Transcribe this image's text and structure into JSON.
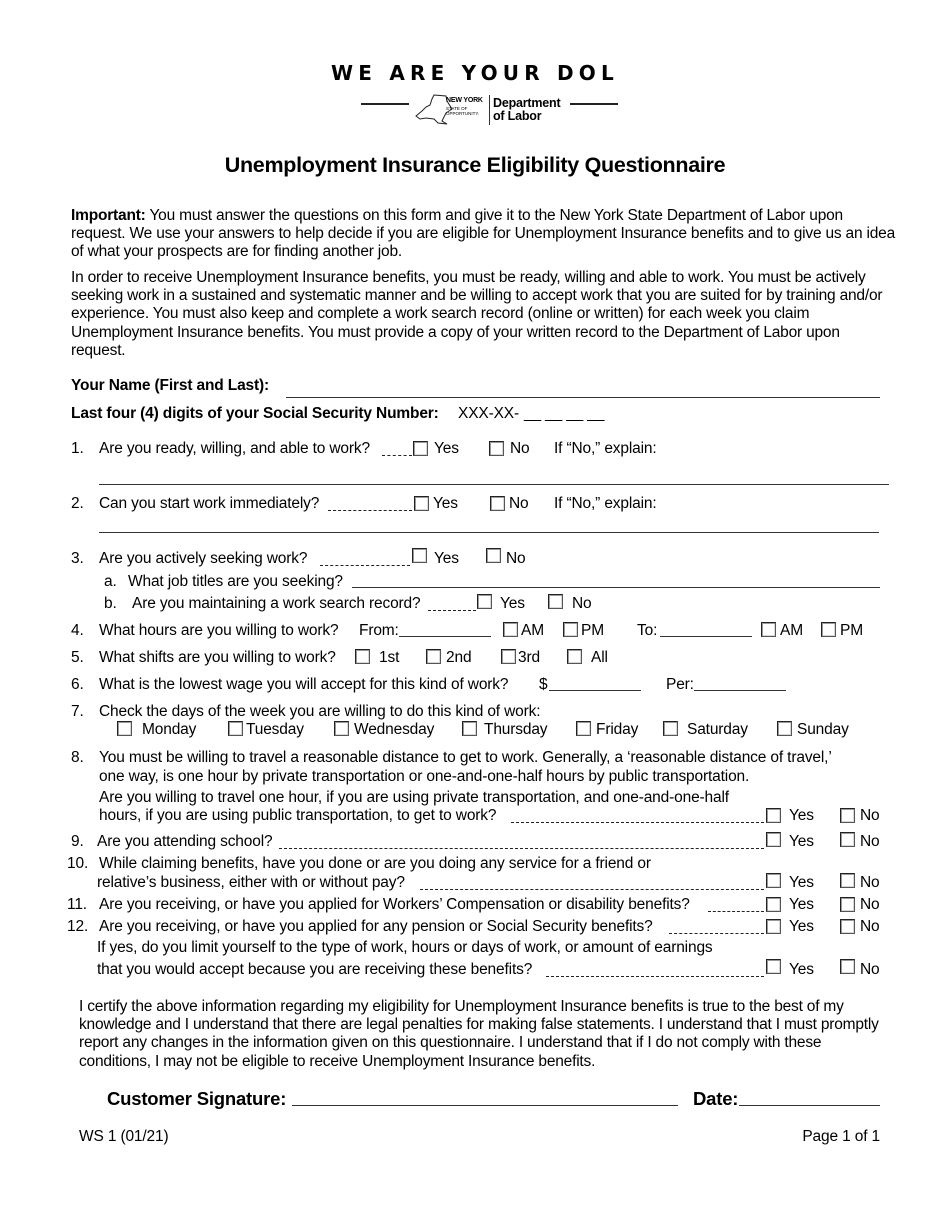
{
  "header": {
    "slogan": "WE ARE YOUR DOL",
    "ny_logo_line1": "NEW YORK",
    "ny_logo_line2": "STATE OF",
    "ny_logo_line3": "OPPORTUNITY.",
    "dept_line1": "Department",
    "dept_line2": "of Labor"
  },
  "title": "Unemployment Insurance Eligibility Questionnaire",
  "intro": {
    "important_label": "Important:",
    "important_text": " You must answer the questions on this form and give it to the New York State Department of Labor upon request. We use your answers to help decide if you are eligible for Unemployment Insurance benefits and to give us an idea of what your prospects are for finding another job.",
    "paragraph2": "In order to receive Unemployment Insurance benefits, you must be ready, willing and able to work. You must be actively seeking work in a sustained and systematic manner and be willing to accept work that you are suited for by training and/or experience. You must also keep and complete a work search record (online or written) for each week you claim Unemployment Insurance benefits. You must provide a copy of your written record to the Department of Labor upon request."
  },
  "fields": {
    "name_label": "Your Name (First and Last):",
    "name_value": "",
    "ssn_label": "Last four (4) digits of your Social Security Number:",
    "ssn_prefix": "XXX-XX-",
    "ssn_blanks": "__ __ __ __"
  },
  "options": {
    "yes": "Yes",
    "no": "No",
    "explain": "If “No,” explain:"
  },
  "questions": {
    "q1": {
      "num": "1.",
      "text": "Are you ready, willing, and able to work?"
    },
    "q2": {
      "num": "2.",
      "text": "Can you start work immediately?"
    },
    "q3": {
      "num": "3.",
      "text": "Are you actively seeking work?",
      "a_num": "a.",
      "a_text": "What job titles are you seeking?",
      "b_num": "b.",
      "b_text": "Are you maintaining a work search record?"
    },
    "q4": {
      "num": "4.",
      "text": "What hours are you willing to work?",
      "from": "From:",
      "to": "To:",
      "am": "AM",
      "pm": "PM"
    },
    "q5": {
      "num": "5.",
      "text": "What shifts are you willing to work?",
      "shifts": [
        "1st",
        "2nd",
        "3rd",
        "All"
      ]
    },
    "q6": {
      "num": "6.",
      "text": "What is the lowest wage you will accept for this kind of work?",
      "dollar": "$",
      "per": "Per:"
    },
    "q7": {
      "num": "7.",
      "text": "Check the days of the week you are willing to do this kind of work:",
      "days": [
        "Monday",
        "Tuesday",
        "Wednesday",
        "Thursday",
        "Friday",
        "Saturday",
        "Sunday"
      ]
    },
    "q8": {
      "num": "8.",
      "line1": "You must be willing to travel a reasonable distance to get to work. Generally, a ‘reasonable distance of travel,’",
      "line2": "one way, is one hour by private transportation or one-and-one-half hours by public transportation.",
      "line3": "Are you willing to travel one hour, if you are using private transportation, and one-and-one-half",
      "line4": "hours, if you are using public transportation, to get to work?"
    },
    "q9": {
      "num": "9.",
      "text": "Are you attending school?"
    },
    "q10": {
      "num": "10.",
      "line1": "While claiming benefits, have you done or are you doing any service for a friend or",
      "line2": "relative’s business, either with or without pay?"
    },
    "q11": {
      "num": "11.",
      "text": "Are you receiving, or have you applied for Workers’ Compensation or disability benefits?"
    },
    "q12": {
      "num": "12.",
      "text": "Are you receiving, or have you applied for any pension or Social Security benefits?",
      "followup_line1": "If yes, do you limit yourself to the type of work, hours or days of work, or amount of earnings",
      "followup_line2": "that you would accept because you are receiving these benefits?"
    }
  },
  "certification": "I certify the above information regarding my eligibility for Unemployment Insurance benefits is true to the best of my knowledge and I understand that there are legal penalties for making false statements. I understand that I must promptly report any changes in the information given on this questionnaire. I understand that if I do not comply with these conditions, I may not be eligible to receive Unemployment Insurance benefits.",
  "signature": {
    "label": "Customer Signature:",
    "date_label": "Date:"
  },
  "footer": {
    "form_id": "WS 1 (01/21)",
    "page": "Page 1 of 1"
  }
}
